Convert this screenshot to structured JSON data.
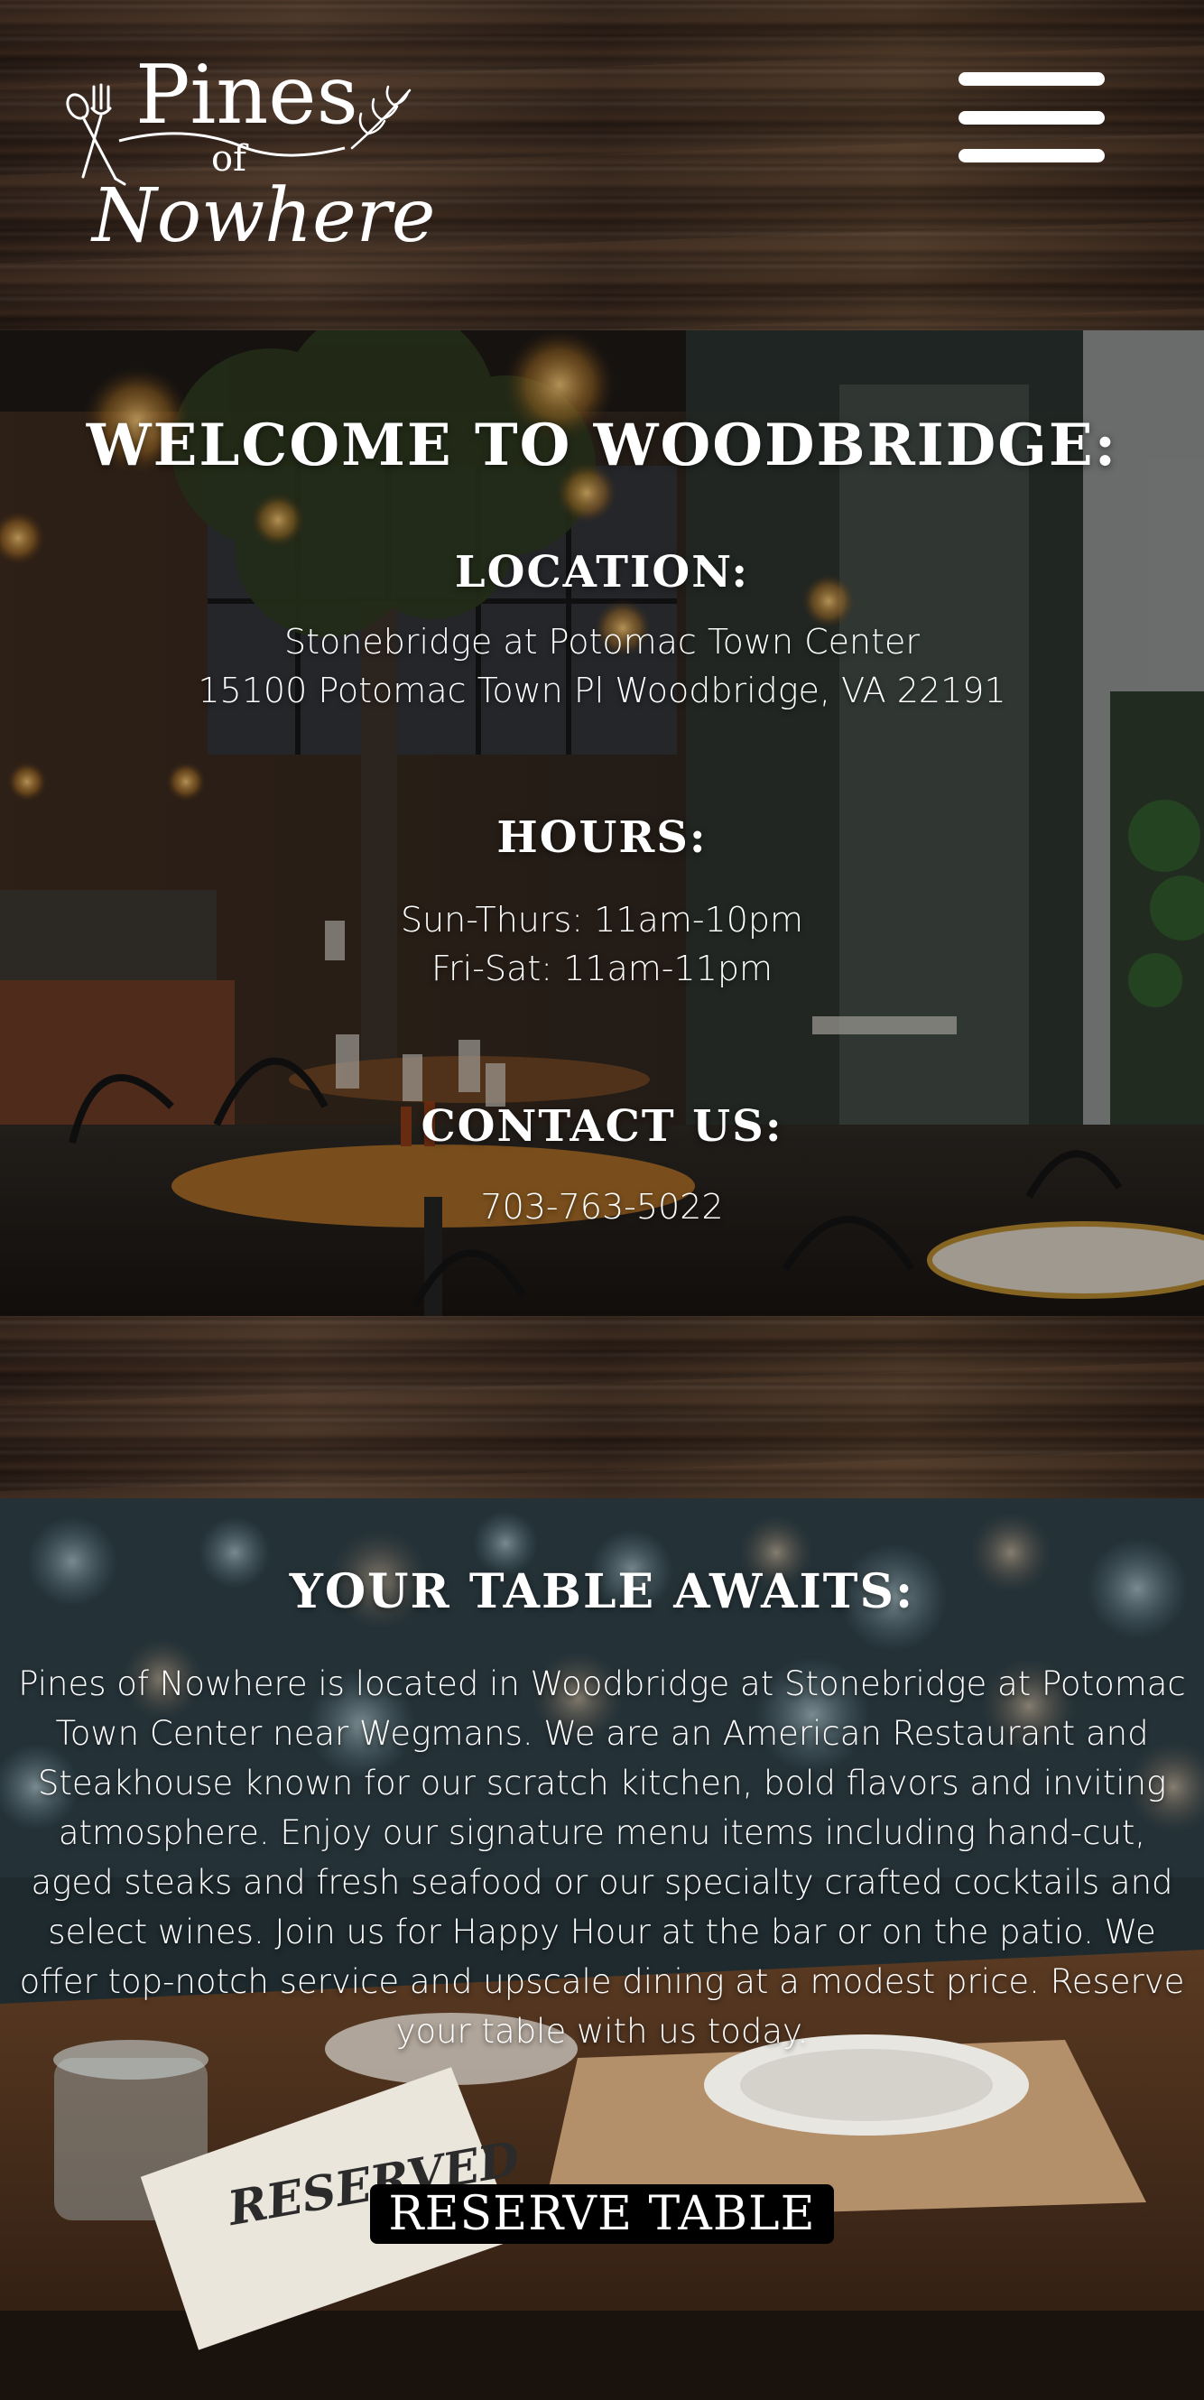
{
  "header": {
    "logo": {
      "line1": "Pines",
      "line2": "of",
      "line3": "Nowhere",
      "icons": [
        "fork-spoon-icon",
        "wheat-icon"
      ]
    },
    "menu_icon": "hamburger-menu-icon"
  },
  "welcome": {
    "title": "WELCOME TO WOODBRIDGE:",
    "location": {
      "title": "LOCATION:",
      "line1": "Stonebridge at Potomac Town Center",
      "line2": "15100 Potomac Town Pl Woodbridge, VA 22191"
    },
    "hours": {
      "title": "HOURS:",
      "line1": "Sun-Thurs: 11am-10pm",
      "line2": "Fri-Sat: 11am-11pm"
    },
    "contact": {
      "title": "CONTACT US:",
      "phone": "703-763-5022"
    }
  },
  "awaits": {
    "title": "YOUR TABLE AWAITS:",
    "text": "Pines of Nowhere is located in Woodbridge at Stonebridge at Potomac Town Center near Wegmans. We are an American Restaurant and Steakhouse known for our scratch kitchen, bold flavors and inviting atmosphere. Enjoy our signature menu items including hand-cut, aged steaks and fresh seafood or our specialty crafted cocktails and select wines. Join us for Happy Hour at the bar or on the patio. We offer top-notch service and upscale dining at a modest price. Reserve your table with us today.",
    "button_label": "RESERVE TABLE",
    "sign_text": "RESERVED"
  }
}
